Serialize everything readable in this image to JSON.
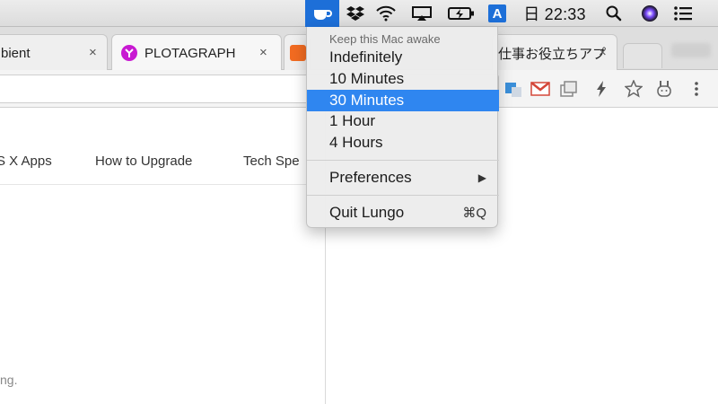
{
  "menubar": {
    "clock": "日 22:33",
    "input_method": "A"
  },
  "tabs": [
    {
      "title": "bient"
    },
    {
      "title": "PLOTAGRAPH"
    },
    {
      "title": ""
    },
    {
      "title": "仕事お役立ちアプ"
    }
  ],
  "tab_close_glyph": "×",
  "nav": {
    "links": [
      "S X Apps",
      "How to Upgrade",
      "Tech Spe"
    ]
  },
  "footer_fragment": "ng.",
  "menu": {
    "header": "Keep this Mac awake",
    "items": [
      "Indefinitely",
      "10 Minutes",
      "30 Minutes",
      "1 Hour",
      "4 Hours"
    ],
    "selected_index": 2,
    "preferences": "Preferences",
    "submenu_arrow": "▶",
    "quit": "Quit Lungo",
    "quit_shortcut": "⌘Q"
  },
  "colors": {
    "menubar_active": "#1d6fd8",
    "menu_highlight": "#2f86f0",
    "gmail_red": "#d44638",
    "plotagraph_magenta": "#c81ad2"
  }
}
